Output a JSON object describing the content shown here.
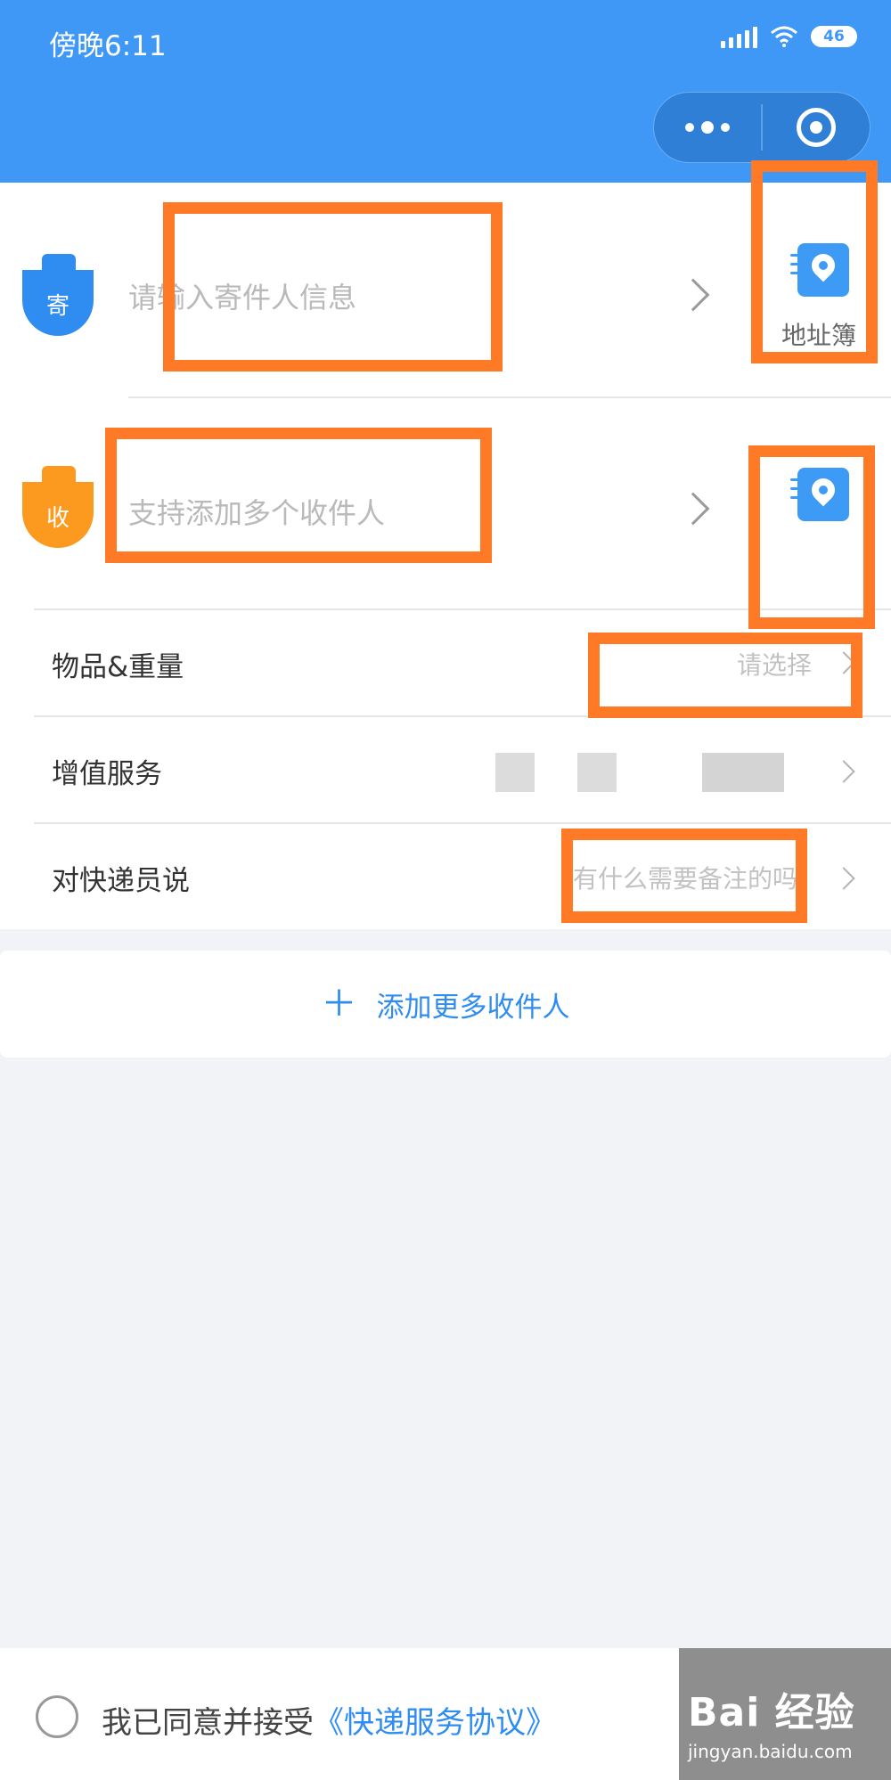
{
  "status_bar": {
    "time": "傍晚6:11",
    "battery": "46"
  },
  "capsule": {
    "more_icon": "more-dots-icon",
    "close_icon": "target-icon"
  },
  "sender": {
    "badge_glyph": "寄",
    "placeholder": "请输入寄件人信息",
    "address_book_label": "地址簿"
  },
  "receiver": {
    "badge_glyph": "收",
    "placeholder": "支持添加多个收件人"
  },
  "items": [
    {
      "label": "物品&重量",
      "value": "请选择"
    },
    {
      "label": "增值服务",
      "value": ""
    },
    {
      "label": "对快递员说",
      "value": "有什么需要备注的吗"
    }
  ],
  "add_more": {
    "label": "添加更多收件人"
  },
  "footer": {
    "agree_text": "我已同意并接受",
    "agreement_link": "《快递服务协议》"
  },
  "watermark": {
    "main": "Bai 经验",
    "sub": "jingyan.baidu.com"
  },
  "colors": {
    "header": "#3f97f6",
    "accent": "#2f8cf0",
    "annotation": "#ff7a27",
    "sender_badge": "#2f8cf0",
    "receiver_badge": "#fb9a1e"
  }
}
